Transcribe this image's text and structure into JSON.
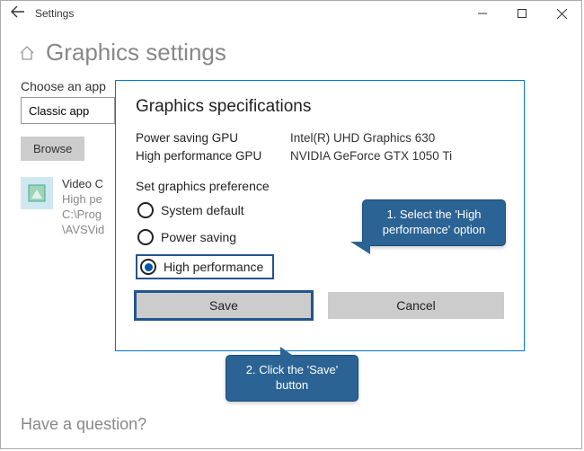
{
  "window": {
    "title": "Settings"
  },
  "page": {
    "heading": "Graphics settings",
    "choose_label": "Choose an app",
    "dropdown_value": "Classic app",
    "browse_label": "Browse",
    "footer": "Have a question?"
  },
  "app_entry": {
    "name": "Video C",
    "line2": "High pe",
    "line3": "C:\\Prog",
    "line4": "\\AVSVid"
  },
  "dialog": {
    "title": "Graphics specifications",
    "gpu_rows": [
      {
        "label": "Power saving GPU",
        "value": "Intel(R) UHD Graphics 630"
      },
      {
        "label": "High performance GPU",
        "value": "NVIDIA GeForce GTX 1050 Ti"
      }
    ],
    "preference_label": "Set graphics preference",
    "options": [
      {
        "label": "System default",
        "selected": false
      },
      {
        "label": "Power saving",
        "selected": false
      },
      {
        "label": "High performance",
        "selected": true
      }
    ],
    "save_label": "Save",
    "cancel_label": "Cancel"
  },
  "callouts": {
    "c1": "1. Select the 'High performance' option",
    "c2": "2. Click the 'Save' button"
  }
}
